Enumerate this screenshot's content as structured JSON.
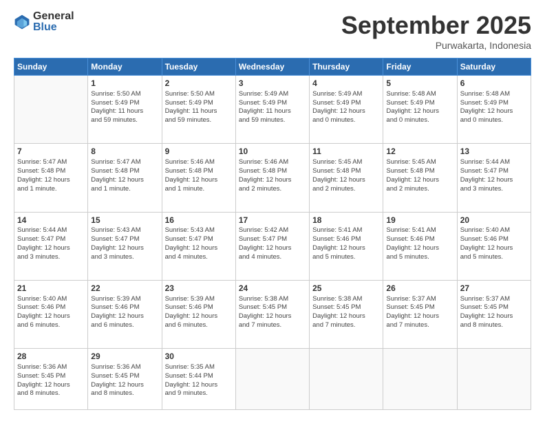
{
  "header": {
    "logo_general": "General",
    "logo_blue": "Blue",
    "month_title": "September 2025",
    "subtitle": "Purwakarta, Indonesia"
  },
  "days_of_week": [
    "Sunday",
    "Monday",
    "Tuesday",
    "Wednesday",
    "Thursday",
    "Friday",
    "Saturday"
  ],
  "weeks": [
    [
      {
        "day": "",
        "info": ""
      },
      {
        "day": "1",
        "info": "Sunrise: 5:50 AM\nSunset: 5:49 PM\nDaylight: 11 hours\nand 59 minutes."
      },
      {
        "day": "2",
        "info": "Sunrise: 5:50 AM\nSunset: 5:49 PM\nDaylight: 11 hours\nand 59 minutes."
      },
      {
        "day": "3",
        "info": "Sunrise: 5:49 AM\nSunset: 5:49 PM\nDaylight: 11 hours\nand 59 minutes."
      },
      {
        "day": "4",
        "info": "Sunrise: 5:49 AM\nSunset: 5:49 PM\nDaylight: 12 hours\nand 0 minutes."
      },
      {
        "day": "5",
        "info": "Sunrise: 5:48 AM\nSunset: 5:49 PM\nDaylight: 12 hours\nand 0 minutes."
      },
      {
        "day": "6",
        "info": "Sunrise: 5:48 AM\nSunset: 5:49 PM\nDaylight: 12 hours\nand 0 minutes."
      }
    ],
    [
      {
        "day": "7",
        "info": "Sunrise: 5:47 AM\nSunset: 5:48 PM\nDaylight: 12 hours\nand 1 minute."
      },
      {
        "day": "8",
        "info": "Sunrise: 5:47 AM\nSunset: 5:48 PM\nDaylight: 12 hours\nand 1 minute."
      },
      {
        "day": "9",
        "info": "Sunrise: 5:46 AM\nSunset: 5:48 PM\nDaylight: 12 hours\nand 1 minute."
      },
      {
        "day": "10",
        "info": "Sunrise: 5:46 AM\nSunset: 5:48 PM\nDaylight: 12 hours\nand 2 minutes."
      },
      {
        "day": "11",
        "info": "Sunrise: 5:45 AM\nSunset: 5:48 PM\nDaylight: 12 hours\nand 2 minutes."
      },
      {
        "day": "12",
        "info": "Sunrise: 5:45 AM\nSunset: 5:48 PM\nDaylight: 12 hours\nand 2 minutes."
      },
      {
        "day": "13",
        "info": "Sunrise: 5:44 AM\nSunset: 5:47 PM\nDaylight: 12 hours\nand 3 minutes."
      }
    ],
    [
      {
        "day": "14",
        "info": "Sunrise: 5:44 AM\nSunset: 5:47 PM\nDaylight: 12 hours\nand 3 minutes."
      },
      {
        "day": "15",
        "info": "Sunrise: 5:43 AM\nSunset: 5:47 PM\nDaylight: 12 hours\nand 3 minutes."
      },
      {
        "day": "16",
        "info": "Sunrise: 5:43 AM\nSunset: 5:47 PM\nDaylight: 12 hours\nand 4 minutes."
      },
      {
        "day": "17",
        "info": "Sunrise: 5:42 AM\nSunset: 5:47 PM\nDaylight: 12 hours\nand 4 minutes."
      },
      {
        "day": "18",
        "info": "Sunrise: 5:41 AM\nSunset: 5:46 PM\nDaylight: 12 hours\nand 5 minutes."
      },
      {
        "day": "19",
        "info": "Sunrise: 5:41 AM\nSunset: 5:46 PM\nDaylight: 12 hours\nand 5 minutes."
      },
      {
        "day": "20",
        "info": "Sunrise: 5:40 AM\nSunset: 5:46 PM\nDaylight: 12 hours\nand 5 minutes."
      }
    ],
    [
      {
        "day": "21",
        "info": "Sunrise: 5:40 AM\nSunset: 5:46 PM\nDaylight: 12 hours\nand 6 minutes."
      },
      {
        "day": "22",
        "info": "Sunrise: 5:39 AM\nSunset: 5:46 PM\nDaylight: 12 hours\nand 6 minutes."
      },
      {
        "day": "23",
        "info": "Sunrise: 5:39 AM\nSunset: 5:46 PM\nDaylight: 12 hours\nand 6 minutes."
      },
      {
        "day": "24",
        "info": "Sunrise: 5:38 AM\nSunset: 5:45 PM\nDaylight: 12 hours\nand 7 minutes."
      },
      {
        "day": "25",
        "info": "Sunrise: 5:38 AM\nSunset: 5:45 PM\nDaylight: 12 hours\nand 7 minutes."
      },
      {
        "day": "26",
        "info": "Sunrise: 5:37 AM\nSunset: 5:45 PM\nDaylight: 12 hours\nand 7 minutes."
      },
      {
        "day": "27",
        "info": "Sunrise: 5:37 AM\nSunset: 5:45 PM\nDaylight: 12 hours\nand 8 minutes."
      }
    ],
    [
      {
        "day": "28",
        "info": "Sunrise: 5:36 AM\nSunset: 5:45 PM\nDaylight: 12 hours\nand 8 minutes."
      },
      {
        "day": "29",
        "info": "Sunrise: 5:36 AM\nSunset: 5:45 PM\nDaylight: 12 hours\nand 8 minutes."
      },
      {
        "day": "30",
        "info": "Sunrise: 5:35 AM\nSunset: 5:44 PM\nDaylight: 12 hours\nand 9 minutes."
      },
      {
        "day": "",
        "info": ""
      },
      {
        "day": "",
        "info": ""
      },
      {
        "day": "",
        "info": ""
      },
      {
        "day": "",
        "info": ""
      }
    ]
  ]
}
